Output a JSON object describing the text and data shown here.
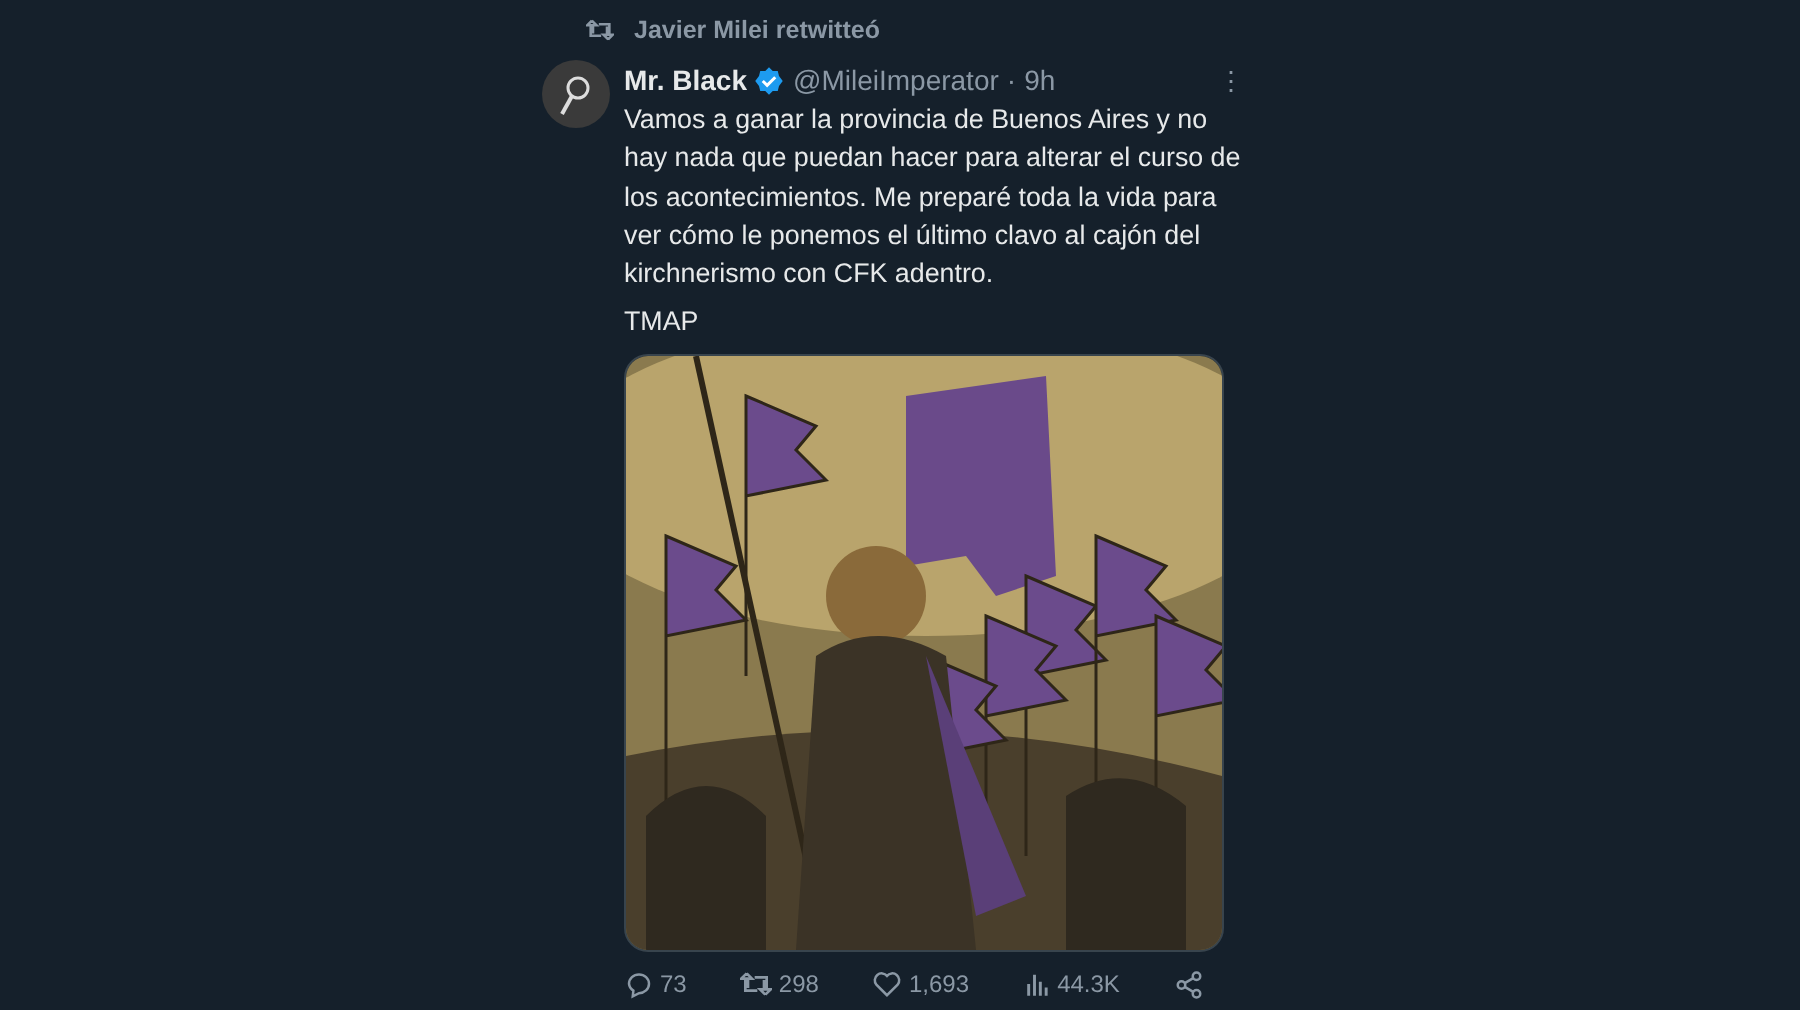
{
  "retweet_header": {
    "label": "Javier Milei retwitteó"
  },
  "tweet": {
    "author_name": "Mr. Black",
    "verified": true,
    "handle": "@MileiImperator",
    "separator": "·",
    "time": "9h",
    "menu": "⋮",
    "paragraphs": [
      "Vamos a ganar la provincia de Buenos Aires y no hay nada que puedan hacer para alterar el curso de los acontecimientos. Me preparé toda la vida para ver cómo le ponemos el último clavo al cajón del kirchnerismo con CFK adentro.",
      "TMAP"
    ],
    "actions": [
      {
        "kind": "reply",
        "count": "73"
      },
      {
        "kind": "retweet",
        "count": "298"
      },
      {
        "kind": "like",
        "count": "1,693"
      },
      {
        "kind": "views",
        "count": "44.3K"
      },
      {
        "kind": "share"
      }
    ]
  }
}
